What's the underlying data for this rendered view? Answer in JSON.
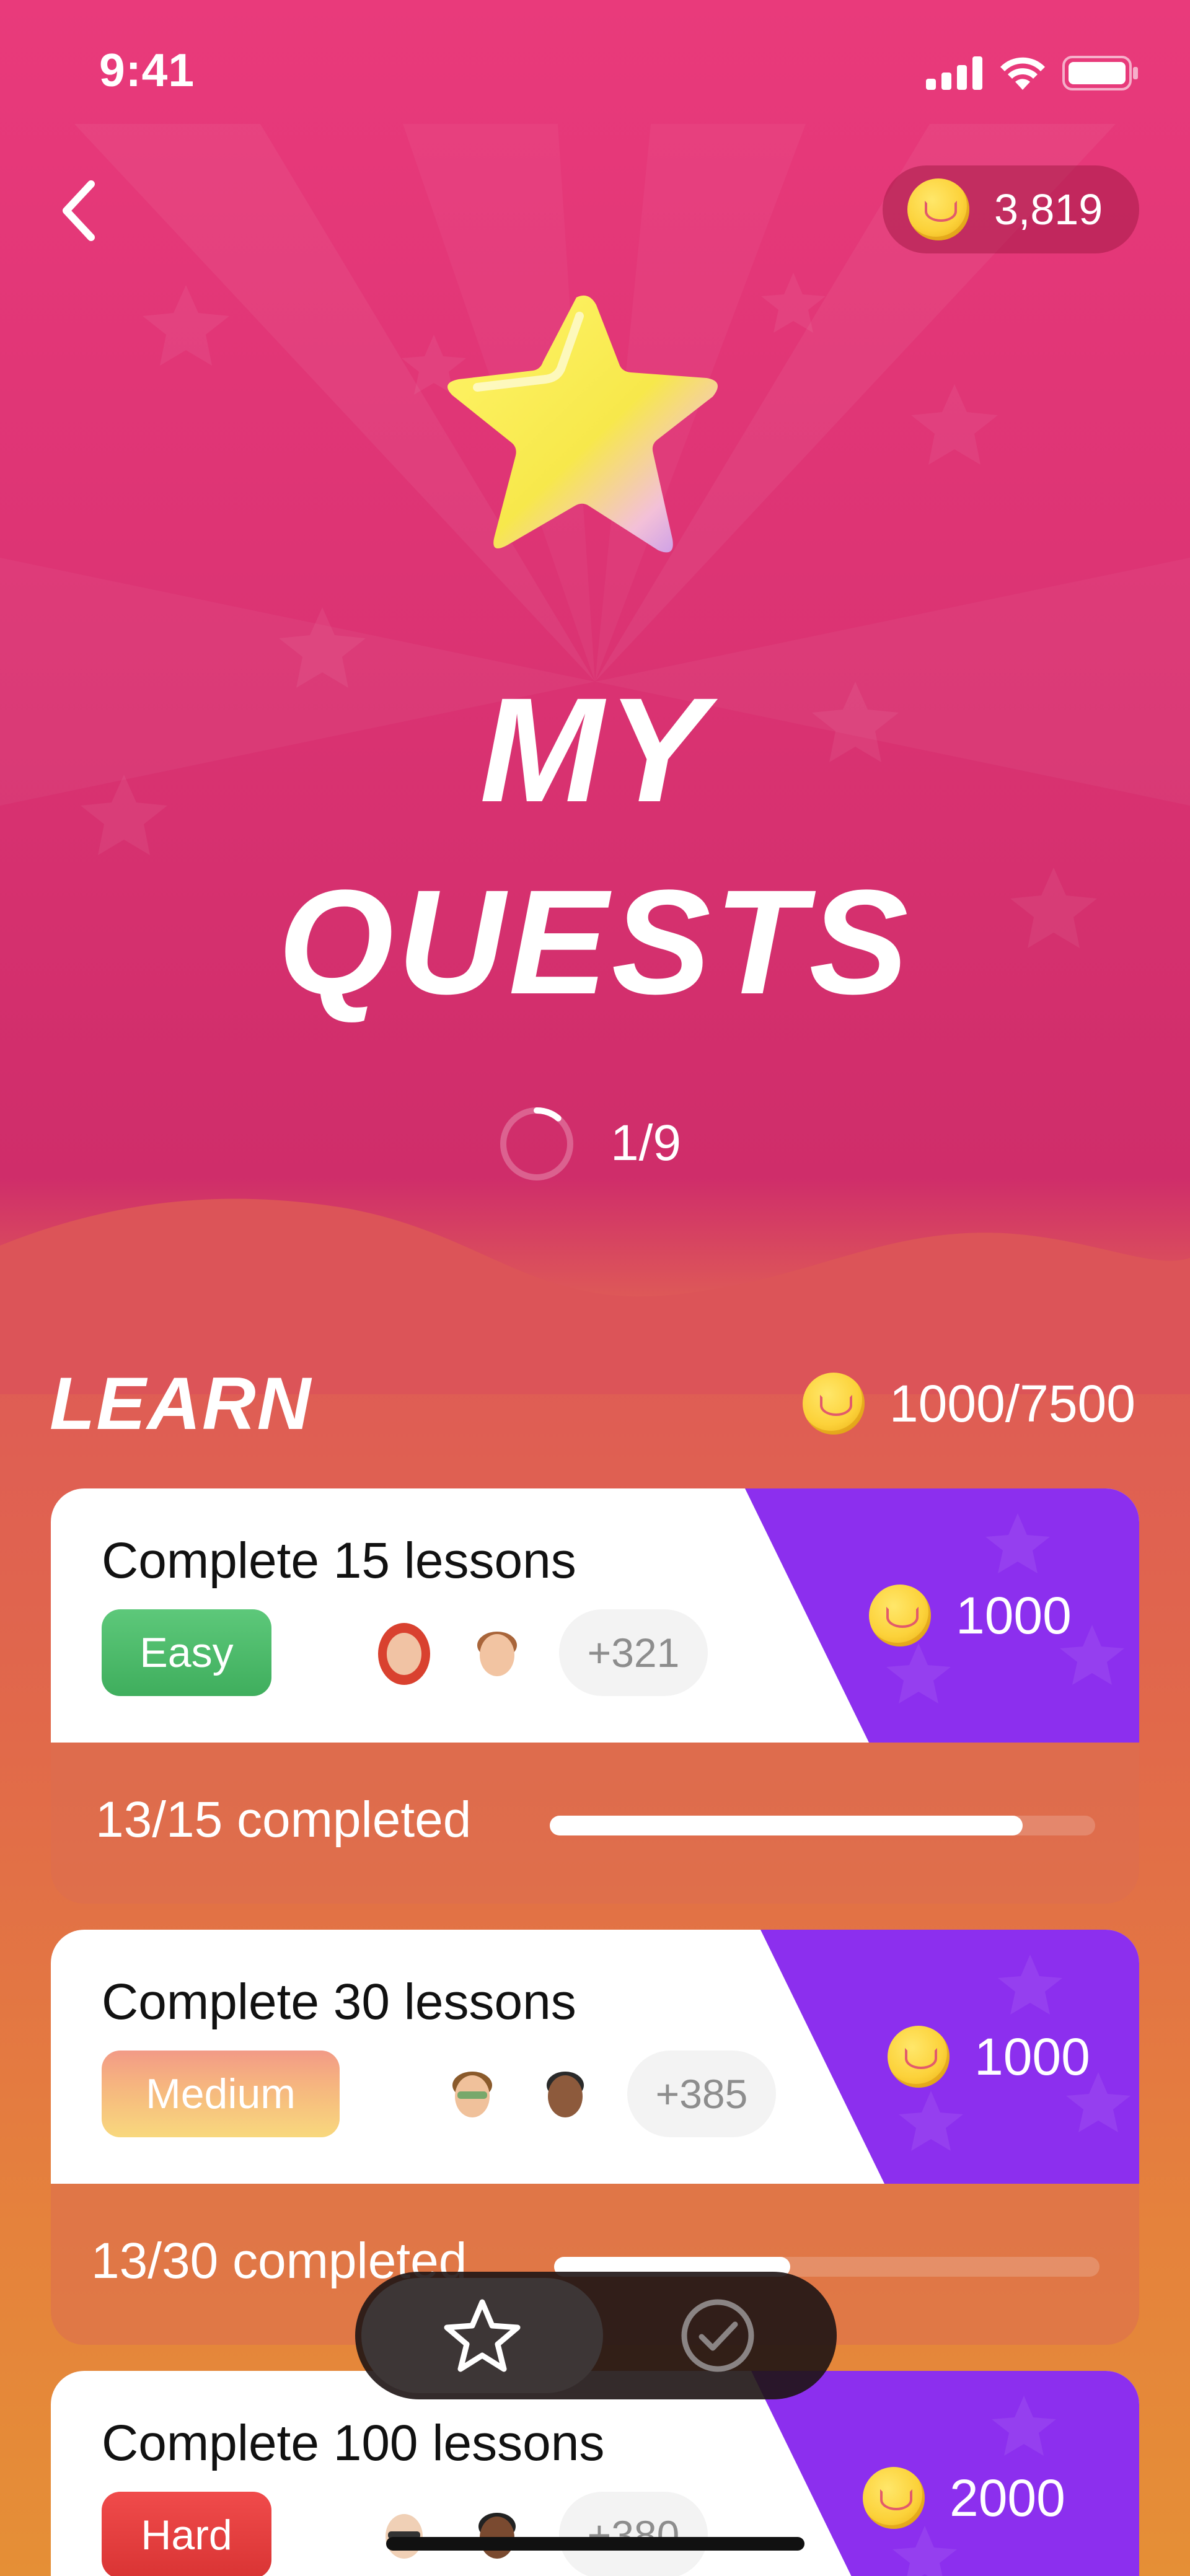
{
  "status_bar": {
    "time": "9:41",
    "icons": [
      "cellular-signal-icon",
      "wifi-icon",
      "battery-icon"
    ]
  },
  "header": {
    "back_icon": "chevron-left-icon",
    "coin_balance": "3,819",
    "coin_icon": "coin-icon"
  },
  "hero": {
    "icon": "star-icon",
    "title_line1": "MY",
    "title_line2": "QUESTS",
    "progress_text": "1/9",
    "progress_fraction": 0.111
  },
  "section": {
    "title": "LEARN",
    "reward": "1000/7500"
  },
  "quests": [
    {
      "title": "Complete 15 lessons",
      "difficulty": "Easy",
      "participants_more": "+321",
      "reward": "1000",
      "progress_text": "13/15 completed",
      "progress_fraction": 0.867
    },
    {
      "title": "Complete 30 lessons",
      "difficulty": "Medium",
      "participants_more": "+385",
      "reward": "1000",
      "progress_text": "13/30 completed",
      "progress_fraction": 0.433
    },
    {
      "title": "Complete 100 lessons",
      "difficulty": "Hard",
      "participants_more": "+380",
      "reward": "2000"
    }
  ],
  "tab_bar": {
    "tabs": [
      {
        "icon": "star-outline-icon",
        "active": true
      },
      {
        "icon": "check-circle-icon",
        "active": false
      }
    ]
  },
  "colors": {
    "hero_pink": "#e93a7b",
    "reward_purple": "#8a2ff0",
    "easy_green": "#4cbb6a",
    "hard_red": "#e63e3e"
  }
}
